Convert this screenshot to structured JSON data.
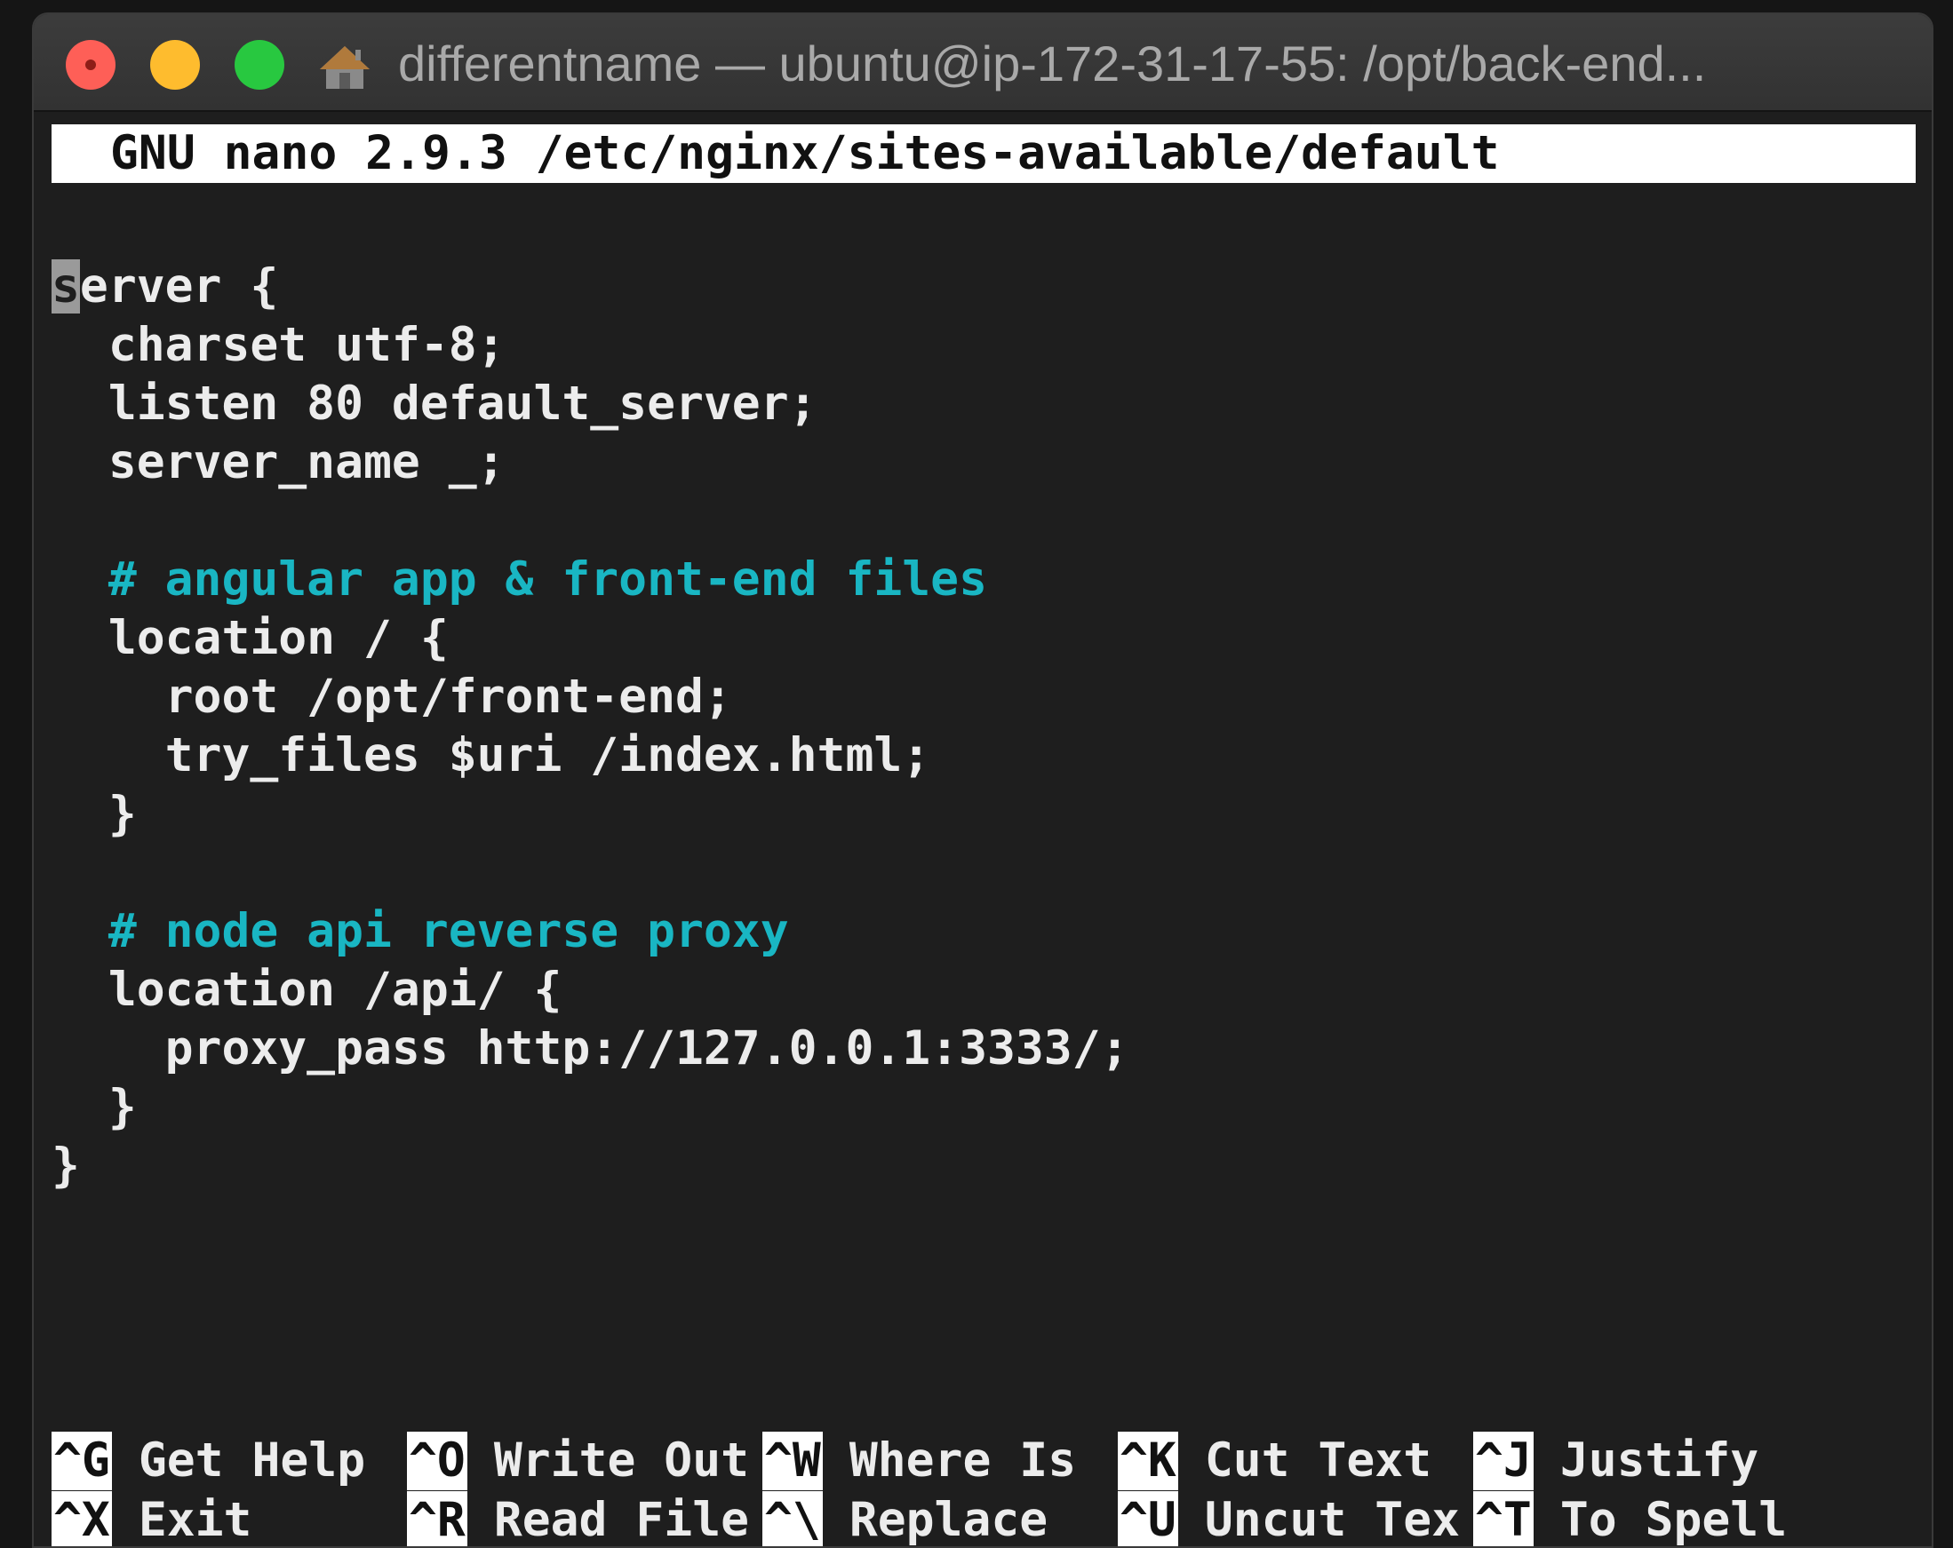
{
  "window": {
    "title": "differentname — ubuntu@ip-172-31-17-55: /opt/back-end..."
  },
  "colors": {
    "close": "#fe5f57",
    "minimize": "#febc2e",
    "maximize": "#28c840",
    "comment": "#19b6c3",
    "text": "#ececec",
    "background": "#1e1e1e"
  },
  "editor": {
    "header": "GNU nano 2.9.3 /etc/nginx/sites-available/default",
    "cursor_char": "s",
    "lines": [
      "erver {",
      "  charset utf-8;",
      "  listen 80 default_server;",
      "  server_name _;",
      "",
      "  # angular app & front-end files",
      "  location / {",
      "    root /opt/front-end;",
      "    try_files $uri /index.html;",
      "  }",
      "",
      "  # node api reverse proxy",
      "  location /api/ {",
      "    proxy_pass http://127.0.0.1:3333/;",
      "  }",
      "}"
    ]
  },
  "shortcuts": {
    "row1": [
      {
        "key": "^G",
        "label": "Get Help"
      },
      {
        "key": "^O",
        "label": "Write Out"
      },
      {
        "key": "^W",
        "label": "Where Is"
      },
      {
        "key": "^K",
        "label": "Cut Text"
      },
      {
        "key": "^J",
        "label": "Justify"
      }
    ],
    "row2": [
      {
        "key": "^X",
        "label": "Exit"
      },
      {
        "key": "^R",
        "label": "Read File"
      },
      {
        "key": "^\\",
        "label": "Replace"
      },
      {
        "key": "^U",
        "label": "Uncut Tex"
      },
      {
        "key": "^T",
        "label": "To Spell"
      }
    ]
  }
}
